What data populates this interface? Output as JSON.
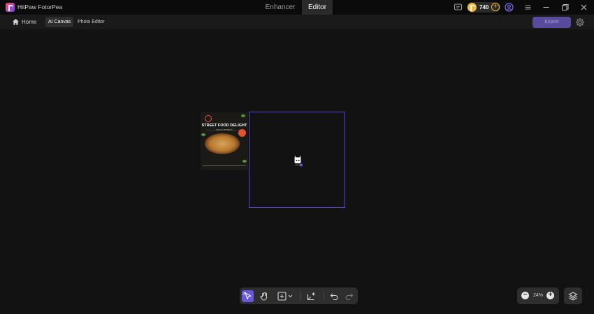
{
  "app": {
    "name": "HitPaw FotorPea"
  },
  "mode_tabs": [
    {
      "label": "Enhancer",
      "active": false
    },
    {
      "label": "Editor",
      "active": true
    }
  ],
  "titlebar": {
    "credits": "740",
    "icons": [
      "feedback-icon",
      "coin-icon",
      "add-credits-icon",
      "account-icon",
      "menu-icon",
      "minimize-icon",
      "restore-icon",
      "close-icon"
    ]
  },
  "subbar": {
    "home_label": "Home",
    "tabs": [
      {
        "label": "AI Canvas",
        "active": true
      },
      {
        "label": "Photo Editor",
        "active": false
      }
    ],
    "export_label": "Export"
  },
  "canvas": {
    "poster": {
      "title": "STREET FOOD DELIGHT",
      "subtitle": "— — — — SNACK PAYMENT — — — —"
    }
  },
  "toolbar": {
    "tools": [
      "select-tool-icon",
      "hand-tool-icon",
      "add-frame-icon",
      "ai-generate-icon",
      "undo-icon",
      "redo-icon"
    ],
    "active_tool": "select-tool-icon"
  },
  "zoom": {
    "value": "24%",
    "minus": "−",
    "plus": "+"
  },
  "colors": {
    "accent": "#6a57e0",
    "frame_border": "#5c47d6",
    "coin": "#f4b73a",
    "background": "#121212"
  }
}
